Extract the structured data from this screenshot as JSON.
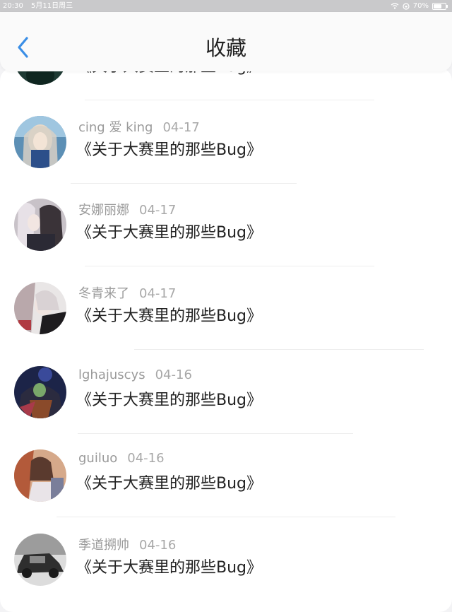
{
  "status_bar": {
    "time": "20:30",
    "date": "5月11日周三",
    "battery": "70%",
    "battery_level": 0.7
  },
  "header": {
    "title": "收藏",
    "back_icon": "chevron-left-icon",
    "accent_color": "#3a8ee6"
  },
  "list": {
    "items": [
      {
        "author": "",
        "date": "",
        "title": "《关于大赛里的那些Bug》"
      },
      {
        "author": "cing 爱 king",
        "date": "04-17",
        "title": "《关于大赛里的那些Bug》"
      },
      {
        "author": "安娜丽娜",
        "date": "04-17",
        "title": "《关于大赛里的那些Bug》"
      },
      {
        "author": "冬青来了",
        "date": "04-17",
        "title": "《关于大赛里的那些Bug》"
      },
      {
        "author": "lghajuscys",
        "date": "04-16",
        "title": "《关于大赛里的那些Bug》"
      },
      {
        "author": "guiluo",
        "date": "04-16",
        "title": "《关于大赛里的那些Bug》"
      },
      {
        "author": "季道搠帅",
        "date": "04-16",
        "title": "《关于大赛里的那些Bug》"
      }
    ]
  }
}
